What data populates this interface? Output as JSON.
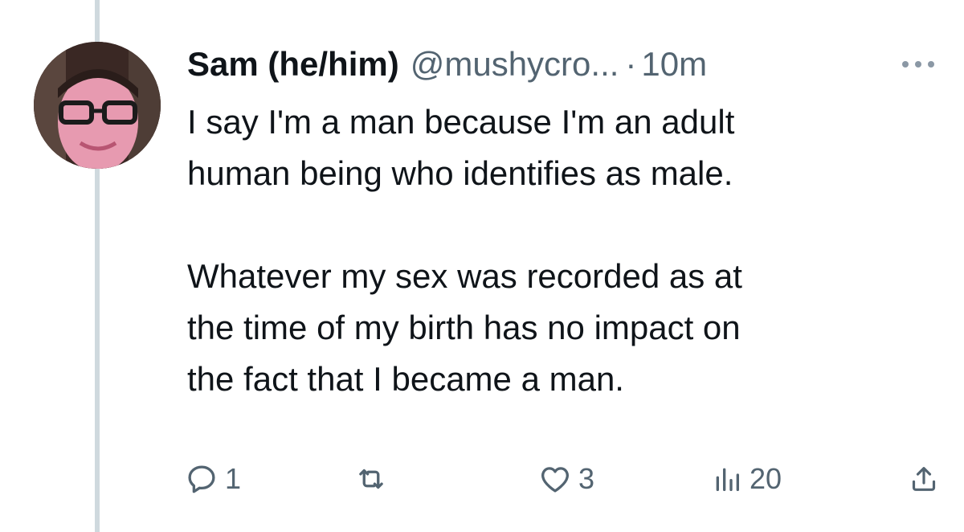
{
  "tweet": {
    "display_name": "Sam (he/him)",
    "handle": "@mushycro...",
    "separator": "·",
    "time": "10m",
    "more_icon": "more-horizontal-icon",
    "avatar_icon": "user-avatar",
    "paragraphs": [
      "I say I'm a man because I'm an adult\nhuman being who identifies as male.",
      "Whatever my sex was recorded as at\nthe time of my birth has no impact on\nthe fact that I became a man."
    ]
  },
  "actions": {
    "reply": {
      "icon": "reply-icon",
      "count": "1"
    },
    "retweet": {
      "icon": "retweet-icon",
      "count": ""
    },
    "like": {
      "icon": "heart-icon",
      "count": "3"
    },
    "views": {
      "icon": "views-icon",
      "count": "20"
    },
    "share": {
      "icon": "share-icon",
      "count": ""
    }
  },
  "colors": {
    "text_primary": "#0f1419",
    "text_secondary": "#536471",
    "thread_line": "#cfd9de"
  }
}
